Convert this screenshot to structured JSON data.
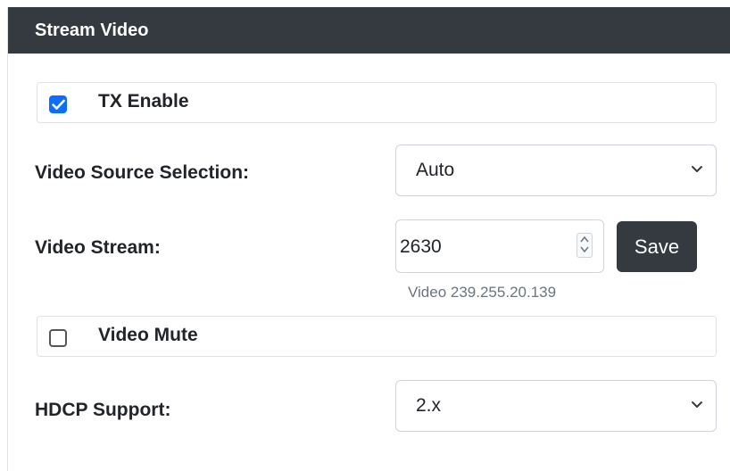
{
  "panel": {
    "title": "Stream Video"
  },
  "tx_enable": {
    "label": "TX Enable",
    "checked": true
  },
  "video_source": {
    "label": "Video Source Selection:",
    "value": "Auto"
  },
  "video_stream": {
    "label": "Video Stream:",
    "value": "2630",
    "save_label": "Save",
    "help": "Video 239.255.20.139"
  },
  "video_mute": {
    "label": "Video Mute",
    "checked": false
  },
  "hdcp": {
    "label": "HDCP Support:",
    "value": "2.x"
  },
  "colors": {
    "header_bg": "#343a40",
    "accent": "#0d6efd",
    "button_bg": "#343a40"
  },
  "icons": [
    "check-icon",
    "chevron-down-icon",
    "spinner-arrows-icon"
  ]
}
